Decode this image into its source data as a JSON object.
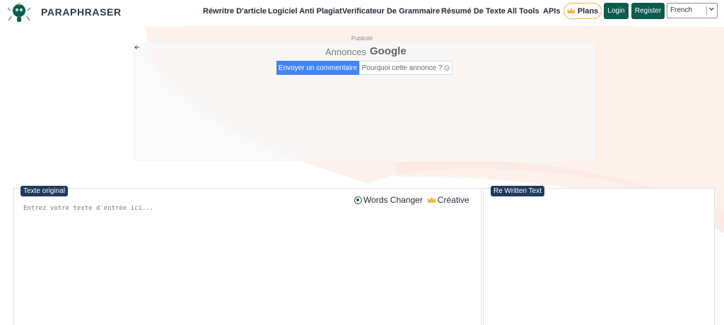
{
  "header": {
    "brand": "PARAPHRASER",
    "nav": [
      {
        "label": "Réwritre D'article"
      },
      {
        "label": "Logiciel Anti Plagiat"
      },
      {
        "label": "Verificateur De Grammaire"
      },
      {
        "label": "Résumé De Texte"
      },
      {
        "label": "All Tools"
      },
      {
        "label": "APIs"
      }
    ],
    "plans_label": "Plans",
    "login_label": "Login",
    "register_label": "Register",
    "language": "French"
  },
  "ad": {
    "label": "Publicité",
    "annonces": "Annonces",
    "google": "Google",
    "send_feedback": "Envoyer un commentaire",
    "why_this_ad": "Pourquoi cette annonce ?"
  },
  "editor": {
    "original_tag": "Texte original",
    "rewritten_tag": "Re Written Text",
    "mode_words": "Words Changer",
    "mode_creative": "Créative",
    "placeholder": "Entrez votre texte d'entrée ici..."
  },
  "colors": {
    "brand_dark": "#0b5c4e",
    "tag_navy": "#1e3a5f",
    "plans_border": "#f2b53f",
    "ad_blue": "#4285f4",
    "bg_wave": "#fdf1ec"
  }
}
